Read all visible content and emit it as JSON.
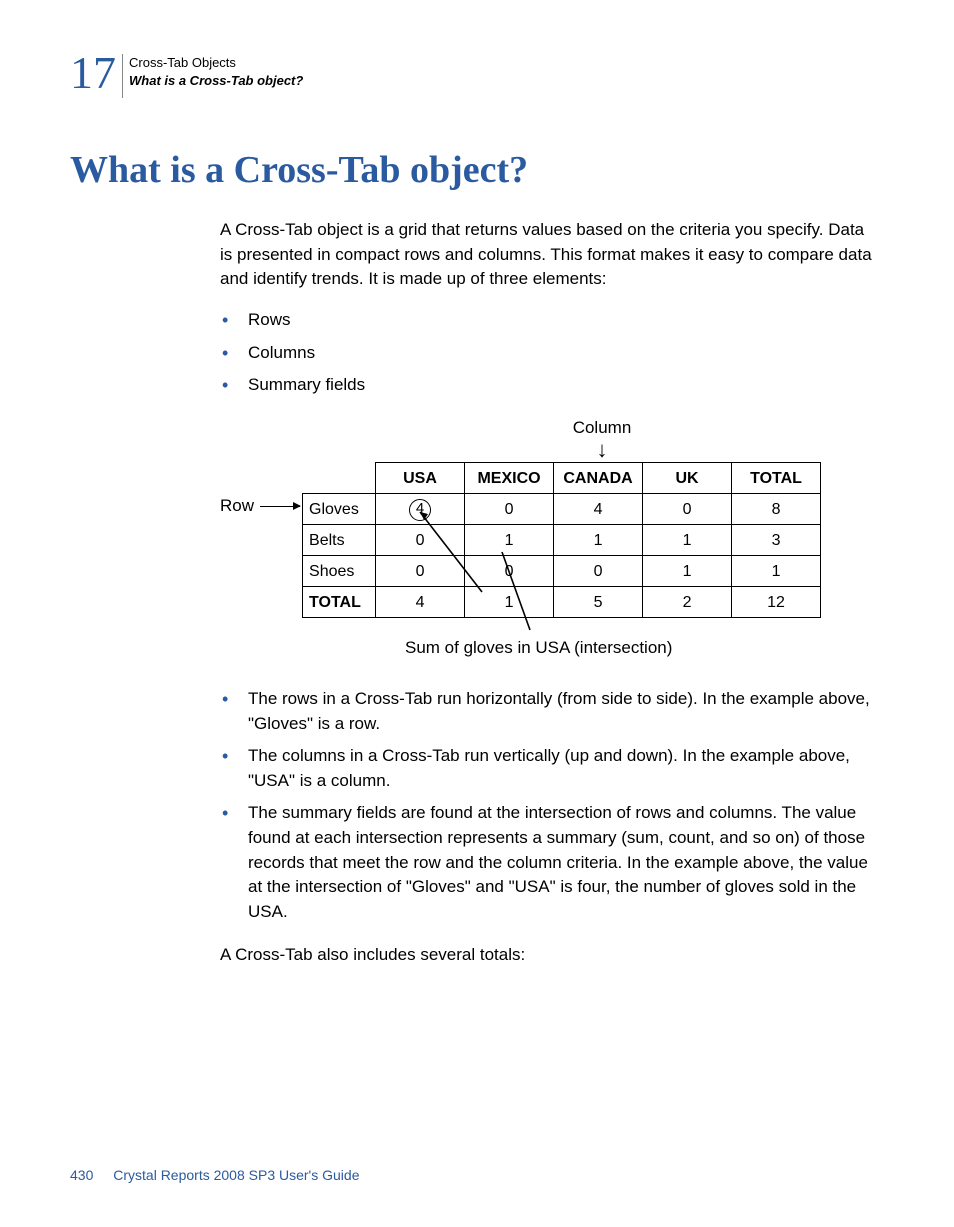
{
  "header": {
    "chapter_number": "17",
    "chapter_title": "Cross-Tab Objects",
    "section_title": "What is a Cross-Tab object?"
  },
  "heading": "What is a Cross-Tab object?",
  "intro": "A Cross-Tab object is a grid that returns values based on the criteria you specify. Data is presented in compact rows and columns. This format makes it easy to compare data and identify trends. It is made up of three elements:",
  "elements_list": {
    "item1": "Rows",
    "item2": "Columns",
    "item3": "Summary fields"
  },
  "figure_labels": {
    "column": "Column",
    "row": "Row",
    "caption": "Sum of gloves in USA (intersection)"
  },
  "chart_data": {
    "type": "table",
    "column_headers": [
      "USA",
      "MEXICO",
      "CANADA",
      "UK",
      "TOTAL"
    ],
    "row_headers": [
      "Gloves",
      "Belts",
      "Shoes",
      "TOTAL"
    ],
    "rows": [
      {
        "label": "Gloves",
        "USA": "4",
        "MEXICO": "0",
        "CANADA": "4",
        "UK": "0",
        "TOTAL": "8"
      },
      {
        "label": "Belts",
        "USA": "0",
        "MEXICO": "1",
        "CANADA": "1",
        "UK": "1",
        "TOTAL": "3"
      },
      {
        "label": "Shoes",
        "USA": "0",
        "MEXICO": "0",
        "CANADA": "0",
        "UK": "1",
        "TOTAL": "1"
      },
      {
        "label": "TOTAL",
        "USA": "4",
        "MEXICO": "1",
        "CANADA": "5",
        "UK": "2",
        "TOTAL": "12"
      }
    ]
  },
  "explain_list": {
    "item1": "The rows in a Cross-Tab run horizontally (from side to side). In the example above, \"Gloves\" is a row.",
    "item2": "The columns in a Cross-Tab run vertically (up and down). In the example above, \"USA\" is a column.",
    "item3": "The summary fields are found at the intersection of rows and columns. The value found at each intersection represents a summary (sum, count, and so on) of those records that meet the row and the column criteria. In the example above, the value at the intersection of \"Gloves\" and \"USA\" is four, the number of gloves sold in the USA."
  },
  "closing": "A Cross-Tab also includes several totals:",
  "footer": {
    "page_number": "430",
    "book_title": "Crystal Reports 2008 SP3 User's Guide"
  }
}
